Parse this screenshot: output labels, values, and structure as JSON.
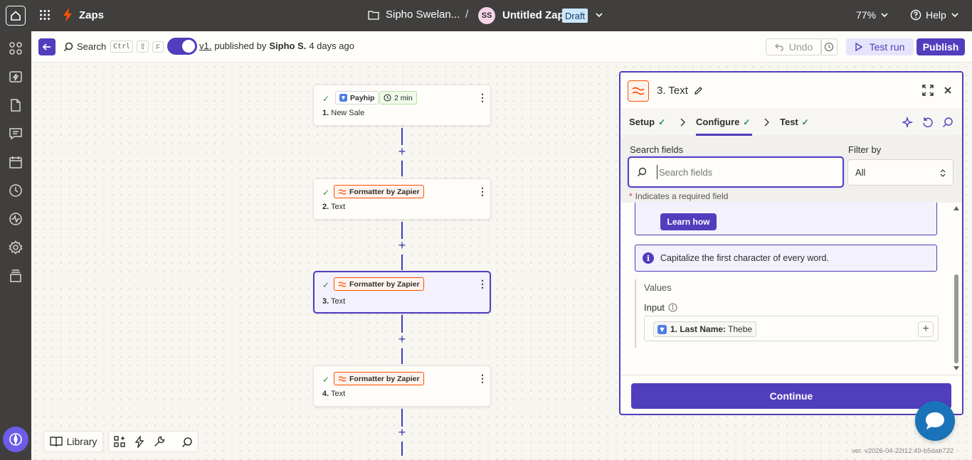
{
  "topbar": {
    "app_title": "Zaps",
    "folder_name": "Sipho Swelan...",
    "separator": "/",
    "avatar_initials": "SS",
    "zap_name": "Untitled Zap",
    "status_badge": "Draft",
    "zoom": "77%",
    "help_label": "Help"
  },
  "toolbar": {
    "search_label": "Search",
    "shortcut_keys": [
      "Ctrl",
      "⇧",
      "F"
    ],
    "version_link": "v1.",
    "published_by_prefix": "published by",
    "published_by_user": "Sipho S.",
    "published_when": "4 days ago",
    "undo_label": "Undo",
    "test_run_label": "Test run",
    "publish_label": "Publish"
  },
  "canvas": {
    "nodes": [
      {
        "number": "1.",
        "name": "New Sale",
        "app": "Payhip",
        "badge_extra": "2 min"
      },
      {
        "number": "2.",
        "name": "Text",
        "app": "Formatter by Zapier"
      },
      {
        "number": "3.",
        "name": "Text",
        "app": "Formatter by Zapier"
      },
      {
        "number": "4.",
        "name": "Text",
        "app": "Formatter by Zapier"
      }
    ],
    "library_label": "Library"
  },
  "panel": {
    "title": "3. Text",
    "tabs": [
      {
        "label": "Setup"
      },
      {
        "label": "Configure"
      },
      {
        "label": "Test"
      }
    ],
    "search_fields_label": "Search fields",
    "search_placeholder": "Search fields",
    "filter_label": "Filter by",
    "filter_value": "All",
    "required_note_star": "*",
    "required_note": "Indicates a required field",
    "learn_how_label": "Learn how",
    "info_text": "Capitalize the first character of every word.",
    "values_heading": "Values",
    "input_label": "Input",
    "input_chip_label": "1. Last Name:",
    "input_chip_value": "Thebe",
    "continue_label": "Continue"
  },
  "footer": {
    "version": "ver. v2026-04-22t12:49-b5dab722"
  },
  "colors": {
    "topbar_bg": "#403f3e",
    "accent": "#503ebd",
    "brand_orange": "#ff4f00",
    "success": "#2a8c4a"
  }
}
